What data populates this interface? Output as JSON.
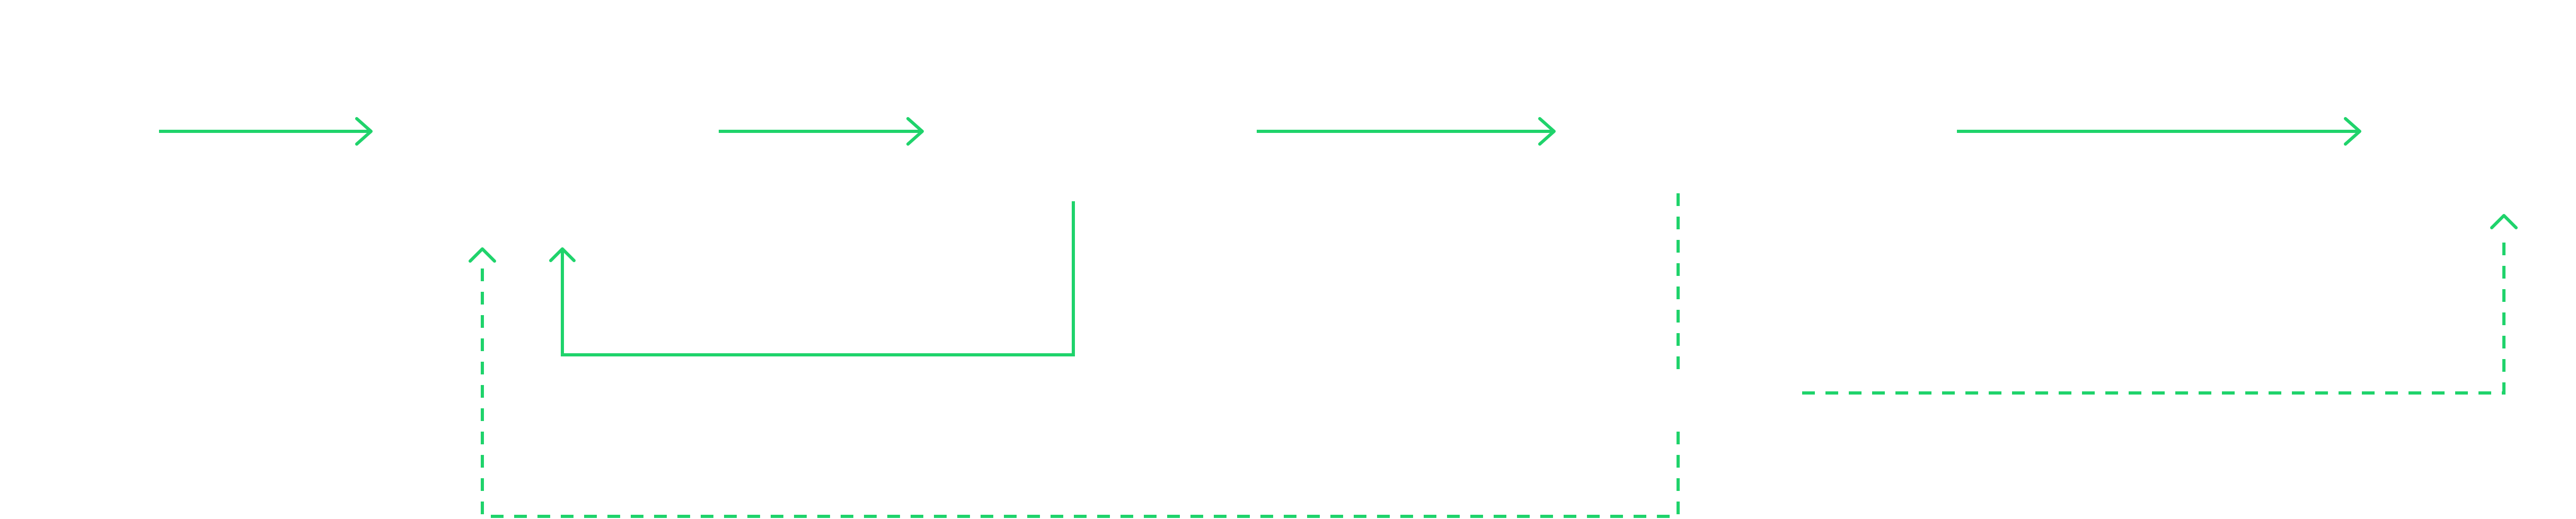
{
  "diagram": {
    "edge_color": "#1fd36b",
    "edges": [
      {
        "id": "edge-1",
        "style": "solid",
        "direction": "right"
      },
      {
        "id": "edge-2",
        "style": "solid",
        "direction": "right"
      },
      {
        "id": "edge-3",
        "style": "solid",
        "direction": "right"
      },
      {
        "id": "edge-4",
        "style": "solid",
        "direction": "right"
      },
      {
        "id": "loop-back-solid",
        "style": "solid",
        "direction": "up"
      },
      {
        "id": "loop-back-dashed",
        "style": "dashed",
        "direction": "up"
      },
      {
        "id": "dashed-forward-link",
        "style": "dashed",
        "direction": "up"
      },
      {
        "id": "dashed-vertical-segment",
        "style": "dashed",
        "direction": "none"
      }
    ]
  }
}
